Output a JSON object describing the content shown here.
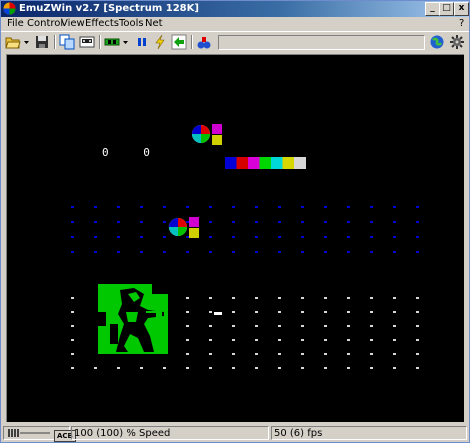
{
  "window": {
    "title": "EmuZWin v2.7 [Spectrum 128K]",
    "controls": {
      "minimize": "_",
      "maximize": "□",
      "close": "x"
    }
  },
  "menu": [
    "File",
    "Control",
    "View",
    "Effects",
    "Tools",
    "Net"
  ],
  "menu_help": "?",
  "toolbar": {
    "icons": [
      "open-folder-icon",
      "dropdown-arrow-icon",
      "save-disk-icon",
      "copy-icon",
      "load-tape-icon",
      "memory-chip-icon",
      "pause-icon",
      "lightning-icon",
      "arrow-icon",
      "speaker-icon",
      "network-icon",
      "settings-icon"
    ],
    "progress": 0
  },
  "status": {
    "volume_label": "ACB",
    "speed": "100 (100) % Speed",
    "fps": "50 (6) fps"
  },
  "colors": {
    "title_start": "#0a246a",
    "title_end": "#a6caf0",
    "chrome": "#d4d0c8",
    "screen": "#000000",
    "sprite_green": "#00c800",
    "dot_blue": "#0000d7",
    "dot_white": "#d7d7d7"
  },
  "screen_text": {
    "digits": "0 0"
  }
}
